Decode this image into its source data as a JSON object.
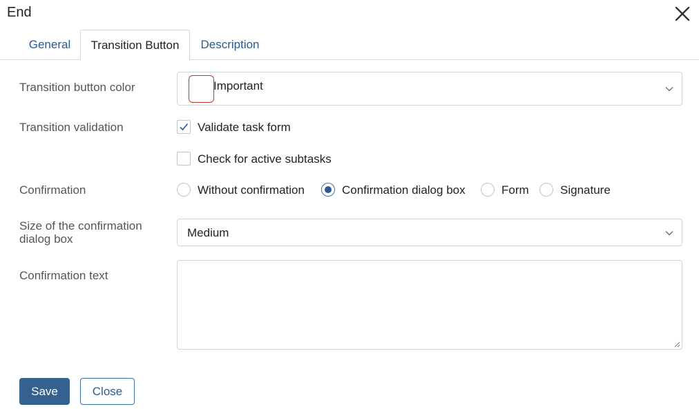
{
  "dialog": {
    "title": "End"
  },
  "tabs": [
    {
      "label": "General",
      "active": false
    },
    {
      "label": "Transition Button",
      "active": true
    },
    {
      "label": "Description",
      "active": false
    }
  ],
  "fields": {
    "color": {
      "label": "Transition button color",
      "value": "Important",
      "swatch_color": "#c0392b"
    },
    "validation": {
      "label": "Transition validation",
      "options": [
        {
          "label": "Validate task form",
          "checked": true
        },
        {
          "label": "Check for active subtasks",
          "checked": false
        }
      ]
    },
    "confirmation": {
      "label": "Confirmation",
      "options": [
        {
          "label": "Without confirmation",
          "selected": false
        },
        {
          "label": "Confirmation dialog box",
          "selected": true
        },
        {
          "label": "Form",
          "selected": false
        },
        {
          "label": "Signature",
          "selected": false
        }
      ]
    },
    "dialog_size": {
      "label_line1": "Size of the confirmation",
      "label_line2": "dialog box",
      "value": "Medium"
    },
    "confirmation_text": {
      "label": "Confirmation text",
      "value": ""
    }
  },
  "buttons": {
    "save": "Save",
    "close": "Close"
  },
  "colors": {
    "accent": "#2a5a8f",
    "primary_button": "#34618f",
    "border": "#cfd6dd"
  }
}
